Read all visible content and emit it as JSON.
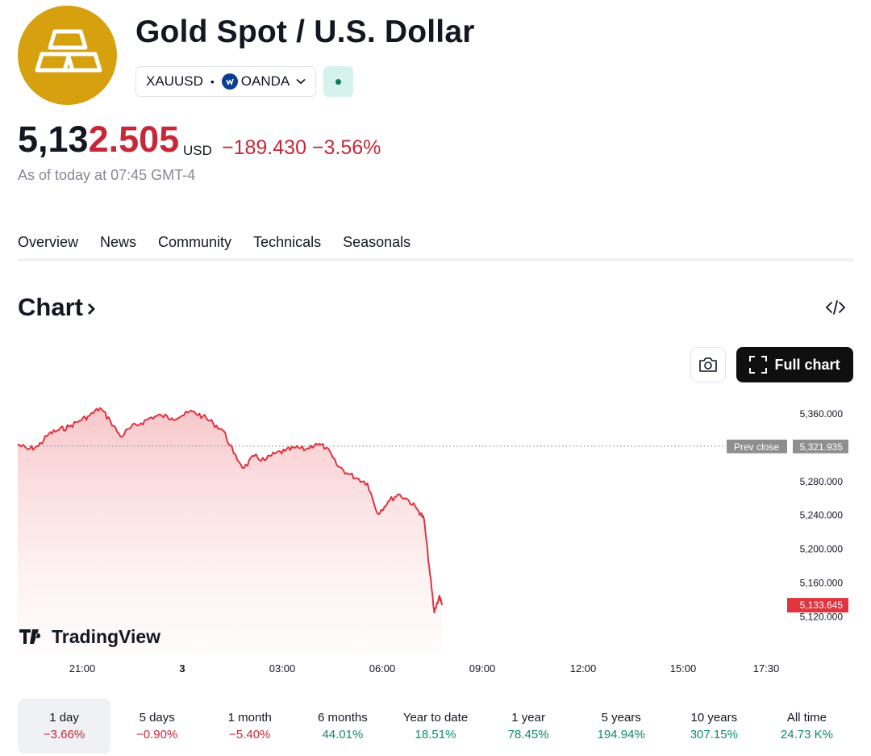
{
  "header": {
    "logo_icon": "gold-bars-icon",
    "title": "Gold Spot / U.S. Dollar",
    "symbol": "XAUUSD",
    "separator": "•",
    "exchange": "OANDA",
    "exchange_icon": "oanda-icon",
    "market_status": "open",
    "market_status_color": "#0c7a5c"
  },
  "quote": {
    "price_main": "5,13",
    "price_highlight": "2.505",
    "currency": "USD",
    "change": "−189.430",
    "change_percent": "−3.56%",
    "as_of": "As of today at 07:45 GMT-4",
    "negative_color": "#c62838"
  },
  "tabs": [
    {
      "label": "Overview",
      "active": true
    },
    {
      "label": "News",
      "active": false
    },
    {
      "label": "Community",
      "active": false
    },
    {
      "label": "Technicals",
      "active": false
    },
    {
      "label": "Seasonals",
      "active": false
    }
  ],
  "chart_section": {
    "heading": "Chart",
    "embed_icon": "code-icon",
    "snapshot_icon": "camera-icon",
    "full_chart_label": "Full chart",
    "full_chart_icon": "fullscreen-icon",
    "watermark": "TradingView"
  },
  "chart_data": {
    "type": "area",
    "series_color": "#e0343f",
    "y_ticks": [
      "5,360.000",
      "5,280.000",
      "5,240.000",
      "5,200.000",
      "5,160.000",
      "5,120.000"
    ],
    "y_tick_values": [
      5360,
      5280,
      5240,
      5200,
      5160,
      5120
    ],
    "x_ticks": [
      "21:00",
      "3",
      "03:00",
      "06:00",
      "09:00",
      "12:00",
      "15:00",
      "17:30"
    ],
    "prev_close_label": "Prev close",
    "prev_close_value": "5,321.935",
    "prev_close": 5321.935,
    "last_value_label": "5,133.645",
    "last_value": 5133.645,
    "x": [
      "18:00",
      "18:20",
      "18:40",
      "19:00",
      "19:20",
      "19:40",
      "20:00",
      "20:20",
      "20:40",
      "21:00",
      "21:20",
      "21:40",
      "22:00",
      "22:20",
      "22:40",
      "23:00",
      "23:20",
      "23:40",
      "00:00",
      "00:20",
      "00:40",
      "01:00",
      "01:20",
      "01:40",
      "02:00",
      "02:20",
      "02:40",
      "03:00",
      "03:20",
      "03:40",
      "04:00",
      "04:20",
      "04:40",
      "05:00",
      "05:20",
      "05:40",
      "06:00",
      "06:20",
      "06:40",
      "07:00",
      "07:10",
      "07:20",
      "07:30",
      "07:40",
      "07:45"
    ],
    "values": [
      5324,
      5318,
      5322,
      5336,
      5341,
      5345,
      5352,
      5358,
      5367,
      5352,
      5333,
      5344,
      5349,
      5356,
      5358,
      5355,
      5358,
      5363,
      5357,
      5349,
      5340,
      5313,
      5296,
      5310,
      5305,
      5313,
      5316,
      5320,
      5318,
      5325,
      5320,
      5300,
      5290,
      5284,
      5278,
      5242,
      5256,
      5265,
      5258,
      5245,
      5236,
      5180,
      5125,
      5145,
      5133.645
    ]
  },
  "periods": [
    {
      "label": "1 day",
      "value": "−3.66%",
      "direction": "neg",
      "active": true
    },
    {
      "label": "5 days",
      "value": "−0.90%",
      "direction": "neg",
      "active": false
    },
    {
      "label": "1 month",
      "value": "−5.40%",
      "direction": "neg",
      "active": false
    },
    {
      "label": "6 months",
      "value": "44.01%",
      "direction": "pos",
      "active": false
    },
    {
      "label": "Year to date",
      "value": "18.51%",
      "direction": "pos",
      "active": false
    },
    {
      "label": "1 year",
      "value": "78.45%",
      "direction": "pos",
      "active": false
    },
    {
      "label": "5 years",
      "value": "194.94%",
      "direction": "pos",
      "active": false
    },
    {
      "label": "10 years",
      "value": "307.15%",
      "direction": "pos",
      "active": false
    },
    {
      "label": "All time",
      "value": "24.73 K%",
      "direction": "pos",
      "active": false
    }
  ]
}
